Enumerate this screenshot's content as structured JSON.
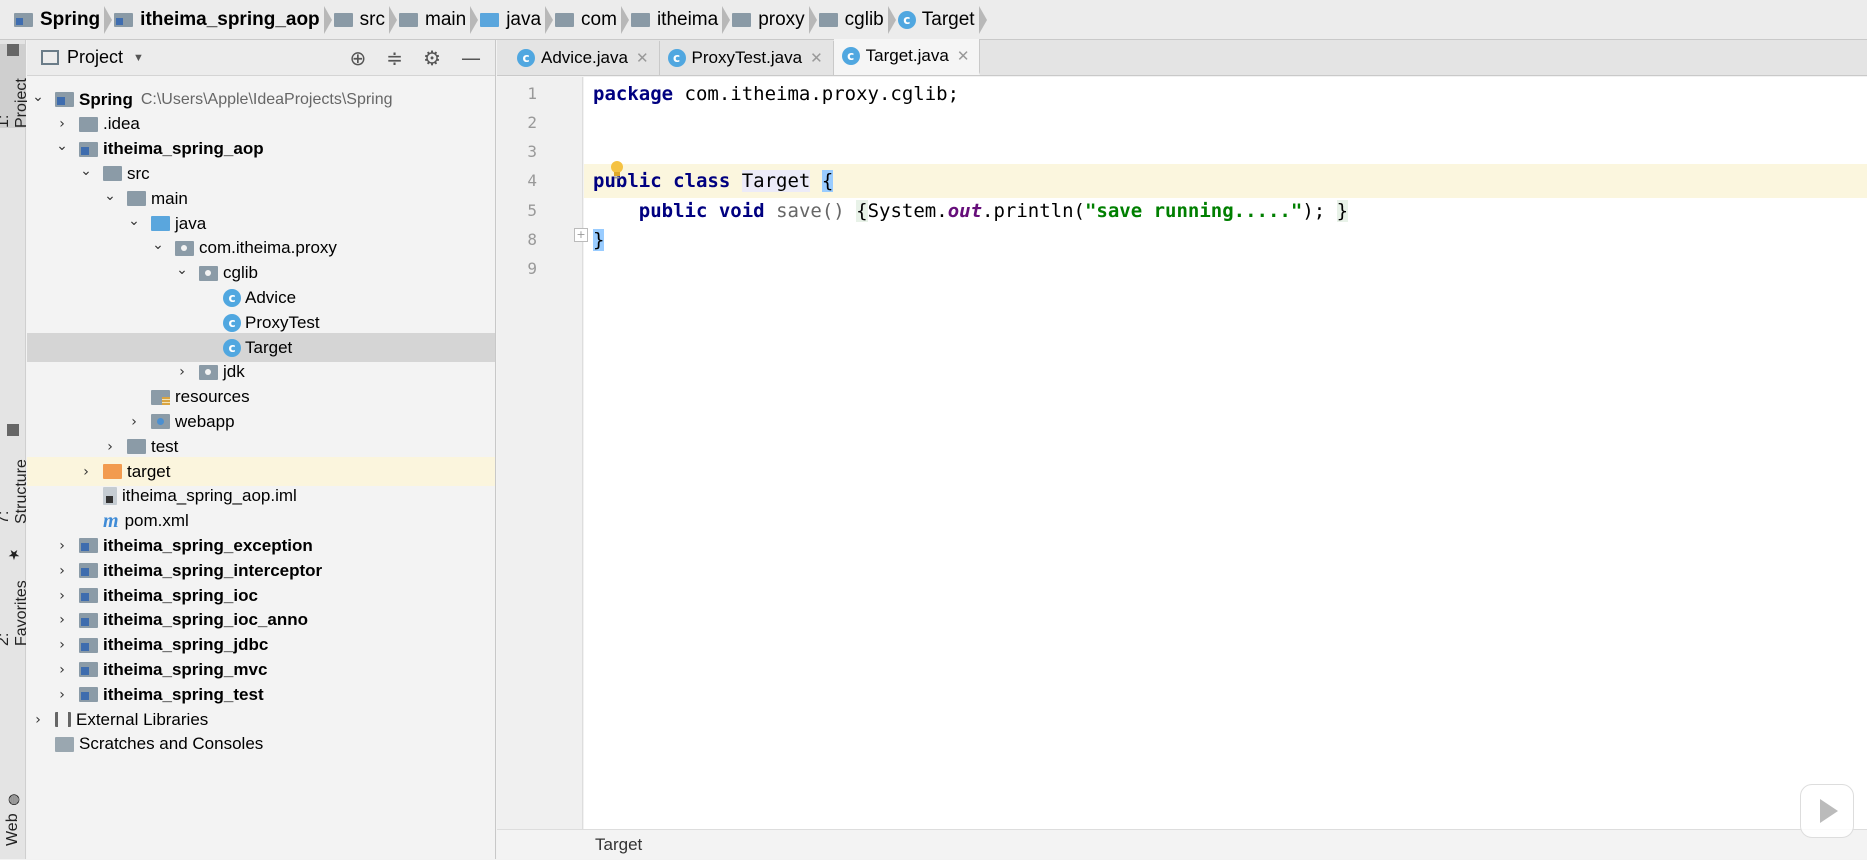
{
  "breadcrumb": [
    {
      "label": "Spring",
      "bold": true,
      "icon": "module-folder-icon"
    },
    {
      "label": "itheima_spring_aop",
      "bold": true,
      "icon": "module-folder-icon"
    },
    {
      "label": "src",
      "icon": "folder-icon"
    },
    {
      "label": "main",
      "icon": "folder-icon"
    },
    {
      "label": "java",
      "icon": "source-folder-icon"
    },
    {
      "label": "com",
      "icon": "folder-icon"
    },
    {
      "label": "itheima",
      "icon": "folder-icon"
    },
    {
      "label": "proxy",
      "icon": "folder-icon"
    },
    {
      "label": "cglib",
      "icon": "folder-icon"
    },
    {
      "label": "Target",
      "icon": "class-icon"
    }
  ],
  "left_strip": {
    "project_tab": "1: Project",
    "structure_tab": "7: Structure",
    "favorites_tab": "2: Favorites",
    "web_tab": "Web"
  },
  "project_panel": {
    "title": "Project",
    "tree": [
      {
        "label": "Spring",
        "path": "C:\\Users\\Apple\\IdeaProjects\\Spring",
        "bold": true,
        "indent": 0,
        "arrow": "down",
        "icon": "module"
      },
      {
        "label": ".idea",
        "indent": 1,
        "arrow": "right",
        "icon": "folder"
      },
      {
        "label": "itheima_spring_aop",
        "bold": true,
        "indent": 1,
        "arrow": "down",
        "icon": "module"
      },
      {
        "label": "src",
        "indent": 2,
        "arrow": "down",
        "icon": "folder"
      },
      {
        "label": "main",
        "indent": 3,
        "arrow": "down",
        "icon": "folder"
      },
      {
        "label": "java",
        "indent": 4,
        "arrow": "down",
        "icon": "src"
      },
      {
        "label": "com.itheima.proxy",
        "indent": 5,
        "arrow": "down",
        "icon": "pkg"
      },
      {
        "label": "cglib",
        "indent": 6,
        "arrow": "down",
        "icon": "pkg"
      },
      {
        "label": "Advice",
        "indent": 7,
        "arrow": "none",
        "icon": "class"
      },
      {
        "label": "ProxyTest",
        "indent": 7,
        "arrow": "none",
        "icon": "class"
      },
      {
        "label": "Target",
        "indent": 7,
        "arrow": "none",
        "icon": "class",
        "selected": true
      },
      {
        "label": "jdk",
        "indent": 6,
        "arrow": "right",
        "icon": "pkg"
      },
      {
        "label": "resources",
        "indent": 4,
        "arrow": "none",
        "icon": "res"
      },
      {
        "label": "webapp",
        "indent": 4,
        "arrow": "right",
        "icon": "web"
      },
      {
        "label": "test",
        "indent": 3,
        "arrow": "right",
        "icon": "folder"
      },
      {
        "label": "target",
        "indent": 2,
        "arrow": "right",
        "icon": "tgt",
        "highlight": true
      },
      {
        "label": "itheima_spring_aop.iml",
        "indent": 2,
        "arrow": "none",
        "icon": "file"
      },
      {
        "label": "pom.xml",
        "indent": 2,
        "arrow": "none",
        "icon": "maven"
      },
      {
        "label": "itheima_spring_exception",
        "bold": true,
        "indent": 1,
        "arrow": "right",
        "icon": "module"
      },
      {
        "label": "itheima_spring_interceptor",
        "bold": true,
        "indent": 1,
        "arrow": "right",
        "icon": "module"
      },
      {
        "label": "itheima_spring_ioc",
        "bold": true,
        "indent": 1,
        "arrow": "right",
        "icon": "module"
      },
      {
        "label": "itheima_spring_ioc_anno",
        "bold": true,
        "indent": 1,
        "arrow": "right",
        "icon": "module"
      },
      {
        "label": "itheima_spring_jdbc",
        "bold": true,
        "indent": 1,
        "arrow": "right",
        "icon": "module"
      },
      {
        "label": "itheima_spring_mvc",
        "bold": true,
        "indent": 1,
        "arrow": "right",
        "icon": "module"
      },
      {
        "label": "itheima_spring_test",
        "bold": true,
        "indent": 1,
        "arrow": "right",
        "icon": "module"
      },
      {
        "label": "External Libraries",
        "indent": 0,
        "arrow": "right",
        "icon": "lib"
      },
      {
        "label": "Scratches and Consoles",
        "indent": 0,
        "arrow": "none",
        "icon": "scratch"
      }
    ]
  },
  "tabs": [
    {
      "label": "Advice.java",
      "active": false
    },
    {
      "label": "ProxyTest.java",
      "active": false
    },
    {
      "label": "Target.java",
      "active": true
    }
  ],
  "editor": {
    "line_numbers": [
      "1",
      "2",
      "3",
      "4",
      "5",
      "8",
      "9"
    ],
    "line1": {
      "kw": "package",
      "rest": " com.itheima.proxy.cglib;"
    },
    "line4": {
      "kw": "public class",
      "sp": " ",
      "cls": "Target",
      "sp2": " ",
      "brace": "{"
    },
    "line5": {
      "indent": "    ",
      "kw": "public void",
      "sp": " ",
      "method": "save()",
      "sp2": " ",
      "ob": "{",
      "call1": "System.",
      "field": "out",
      "call2": ".println(",
      "str": "\"save running.....\"",
      "end": ");",
      "sp3": " ",
      "cb": "}"
    },
    "line8": {
      "brace": "}"
    }
  },
  "status": {
    "breadcrumb": "Target"
  }
}
